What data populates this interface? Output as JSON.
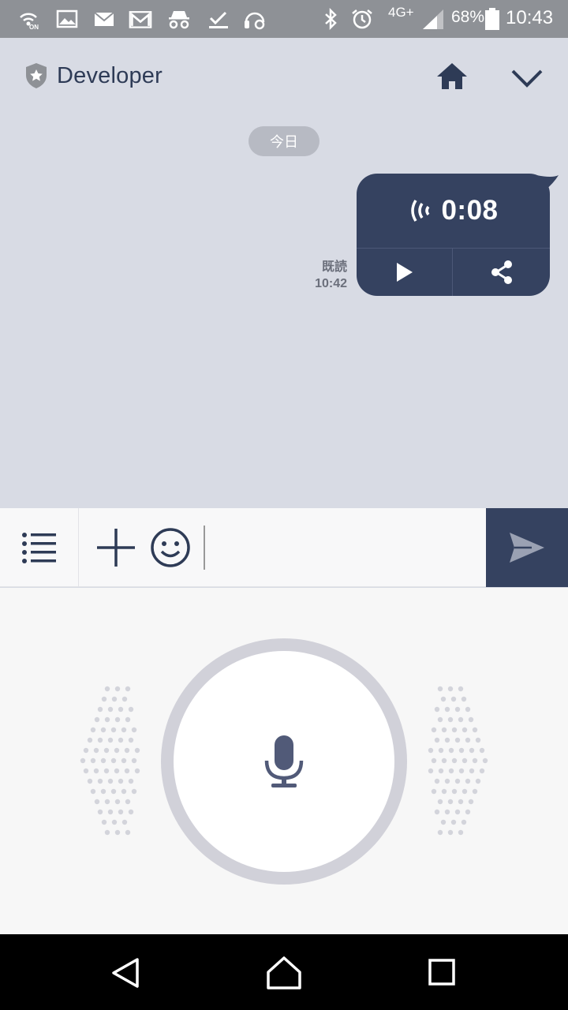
{
  "status_bar": {
    "network": "4G+",
    "battery": "68%",
    "time": "10:43",
    "icons": [
      "wifi-calling-on-icon",
      "image-icon",
      "mail-icon",
      "gmail-icon",
      "incognito-icon",
      "download-done-icon",
      "headset-settings-icon",
      "bluetooth-icon",
      "alarm-icon",
      "signal-icon",
      "battery-icon"
    ]
  },
  "header": {
    "title": "Developer",
    "icons": [
      "shield-star-icon",
      "home-icon",
      "chevron-down-icon"
    ]
  },
  "chat": {
    "date_label": "今日",
    "message": {
      "read_label": "既読",
      "time": "10:42",
      "duration": "0:08",
      "icons": [
        "audio-wave-icon",
        "play-icon",
        "share-icon"
      ]
    }
  },
  "input_bar": {
    "placeholder": "",
    "value": "",
    "icons": [
      "menu-list-icon",
      "plus-icon",
      "emoji-icon",
      "send-icon"
    ]
  },
  "voice_panel": {
    "icons": [
      "microphone-icon"
    ]
  },
  "nav_bar": {
    "icons": [
      "back-icon",
      "home-nav-icon",
      "recents-icon"
    ]
  },
  "colors": {
    "accent": "#354260",
    "chat_background": "#d8dbe4",
    "status_bar": "#8e9196"
  }
}
